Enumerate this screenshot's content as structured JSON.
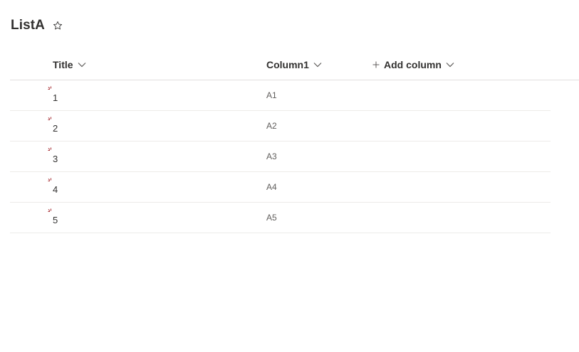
{
  "list": {
    "title": "ListA",
    "favorite_icon": "star-outline-icon"
  },
  "columns": {
    "title_label": "Title",
    "column1_label": "Column1",
    "add_column_label": "Add column"
  },
  "rows": [
    {
      "title": "1",
      "column1": "A1",
      "is_new": true
    },
    {
      "title": "2",
      "column1": "A2",
      "is_new": true
    },
    {
      "title": "3",
      "column1": "A3",
      "is_new": true
    },
    {
      "title": "4",
      "column1": "A4",
      "is_new": true
    },
    {
      "title": "5",
      "column1": "A5",
      "is_new": true
    }
  ],
  "colors": {
    "text": "#323130",
    "secondary_text": "#605e5c",
    "new_indicator": "#a4262c",
    "divider": "#edebe9"
  }
}
